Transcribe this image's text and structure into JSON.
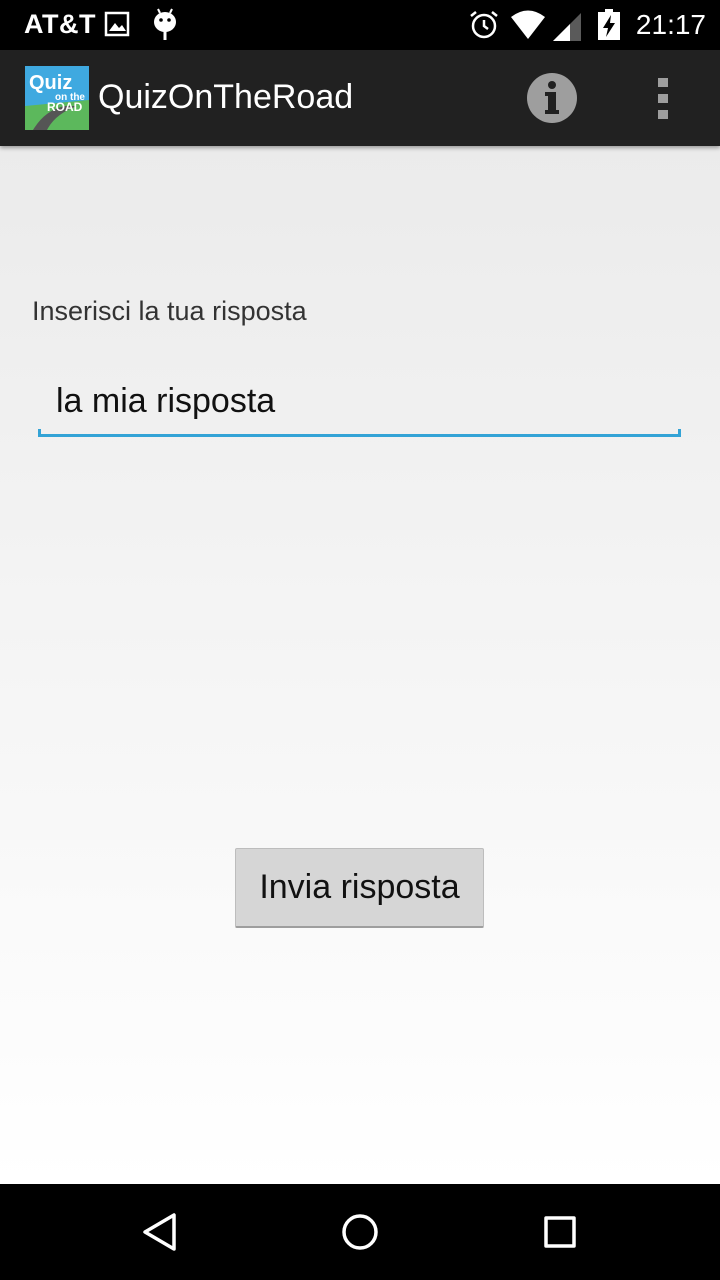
{
  "status_bar": {
    "carrier": "AT&T",
    "time": "21:17",
    "icons": [
      "image-icon",
      "android-debug-icon",
      "alarm-icon",
      "wifi-icon",
      "signal-icon",
      "battery-charging-icon"
    ]
  },
  "action_bar": {
    "logo": {
      "icon": "quiz-on-the-road-logo",
      "text_line1": "Quiz",
      "text_line2": "on the",
      "text_line3": "ROAD"
    },
    "title": "QuizOnTheRoad",
    "info_icon": "info-icon",
    "overflow_icon": "more-vert-icon"
  },
  "form": {
    "prompt": "Inserisci la tua risposta",
    "answer_value": "la mia risposta",
    "submit_label": "Invia risposta",
    "accent_color": "#33a3d6"
  },
  "nav_bar": {
    "icons": [
      "back-icon",
      "home-icon",
      "recents-icon"
    ]
  }
}
